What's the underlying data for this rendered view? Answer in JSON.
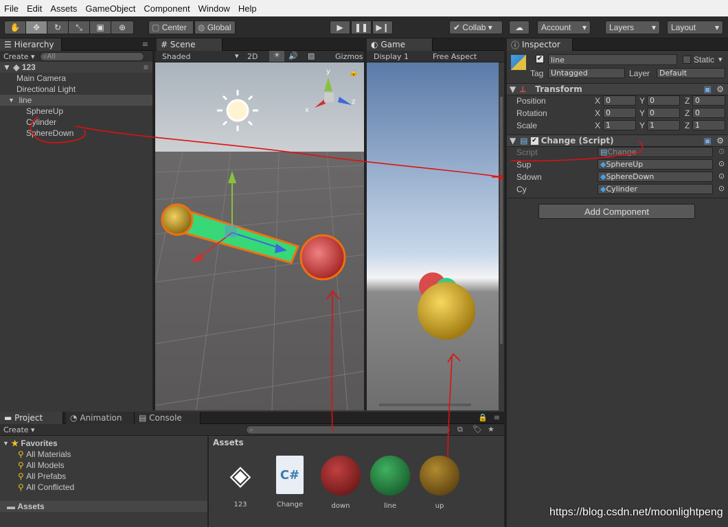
{
  "menu": [
    "File",
    "Edit",
    "Assets",
    "GameObject",
    "Component",
    "Window",
    "Help"
  ],
  "toolbar": {
    "pivot": "Center",
    "space": "Global",
    "collab": "Collab ▾",
    "account": "Account",
    "layers": "Layers",
    "layout": "Layout"
  },
  "hierarchy": {
    "tab": "Hierarchy",
    "create": "Create ▾",
    "search_placeholder": "All",
    "scene": "123",
    "items": [
      "Main Camera",
      "Directional Light",
      "line",
      "SphereUp",
      "Cylinder",
      "SphereDown"
    ]
  },
  "scene": {
    "tab": "Scene",
    "shading": "Shaded",
    "mode2d": "2D",
    "gizmos": "Gizmos",
    "axis_x": "x",
    "axis_y": "y",
    "axis_z": "z"
  },
  "game": {
    "tab": "Game",
    "display": "Display 1",
    "aspect": "Free Aspect"
  },
  "inspector": {
    "tab": "Inspector",
    "object_name": "line",
    "static_label": "Static",
    "tag_label": "Tag",
    "tag_value": "Untagged",
    "layer_label": "Layer",
    "layer_value": "Default",
    "transform": {
      "title": "Transform",
      "position": {
        "label": "Position",
        "x": "0",
        "y": "0",
        "z": "0"
      },
      "rotation": {
        "label": "Rotation",
        "x": "0",
        "y": "0",
        "z": "0"
      },
      "scale": {
        "label": "Scale",
        "x": "1",
        "y": "1",
        "z": "1"
      }
    },
    "script": {
      "title": "Change (Script)",
      "fields": [
        {
          "label": "Script",
          "value": "Change"
        },
        {
          "label": "Sup",
          "value": "SphereUp"
        },
        {
          "label": "Sdown",
          "value": "SphereDown"
        },
        {
          "label": "Cy",
          "value": "Cylinder"
        }
      ]
    },
    "add_component": "Add Component",
    "axis": {
      "x": "X",
      "y": "Y",
      "z": "Z"
    }
  },
  "project": {
    "tabs": [
      "Project",
      "Animation",
      "Console"
    ],
    "create": "Create ▾",
    "favorites_title": "Favorites",
    "favorites": [
      "All Materials",
      "All Models",
      "All Prefabs",
      "All Conflicted"
    ],
    "assets_folder": "Assets",
    "assets_header": "Assets",
    "assets": [
      {
        "name": "123",
        "kind": "unity-scene-icon"
      },
      {
        "name": "Change",
        "kind": "csharp-script-icon"
      },
      {
        "name": "down",
        "kind": "material",
        "color": "#8a1c1c"
      },
      {
        "name": "line",
        "kind": "material",
        "color": "#1c7a3a"
      },
      {
        "name": "up",
        "kind": "material",
        "color": "#7a5a10"
      }
    ]
  },
  "watermark": "https://blog.csdn.net/moonlightpeng",
  "colors": {
    "accent": "#3a6fb0",
    "annotation_red": "#e01010",
    "sphere_red": "#d94a4a",
    "sphere_yellow": "#e8b830",
    "cylinder_green": "#38d878"
  }
}
